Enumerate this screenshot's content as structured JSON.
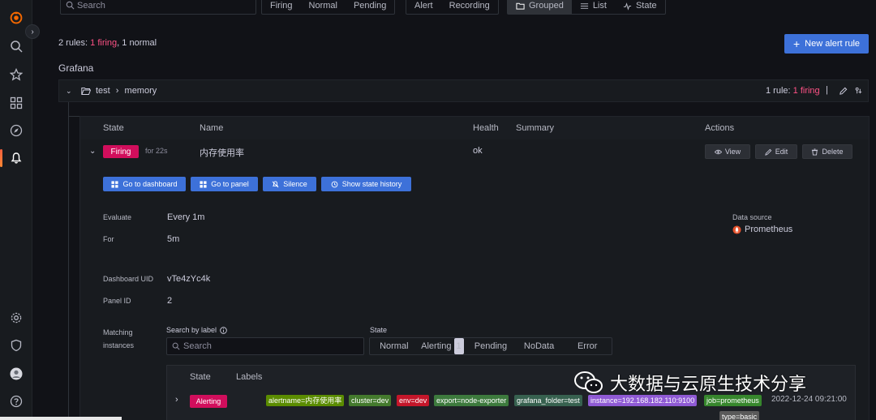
{
  "top_filters": {
    "search_placeholder": "Search",
    "states": [
      "Firing",
      "Normal",
      "Pending"
    ],
    "types": [
      "Alert",
      "Recording"
    ],
    "views": [
      "Grouped",
      "List",
      "State"
    ]
  },
  "summary": {
    "prefix": "2 rules: ",
    "firing": "1 firing",
    "sep": ", ",
    "normal": "1 normal"
  },
  "new_alert_label": "New alert rule",
  "datasource_group": "Grafana",
  "folder": {
    "folder_name": "test",
    "separator": "›",
    "group_name": "memory",
    "count_prefix": "1 rule: ",
    "count_firing": "1 firing",
    "divider": "|"
  },
  "rule_table": {
    "headers": {
      "state": "State",
      "name": "Name",
      "health": "Health",
      "summary": "Summary",
      "actions": "Actions"
    },
    "row": {
      "state": "Firing",
      "duration": "for 22s",
      "name": "内存使用率",
      "health": "ok",
      "actions": [
        "View",
        "Edit",
        "Delete"
      ]
    }
  },
  "quick_actions": [
    "Go to dashboard",
    "Go to panel",
    "Silence",
    "Show state history"
  ],
  "details": {
    "evaluate_label": "Evaluate",
    "evaluate_value": "Every 1m",
    "for_label": "For",
    "for_value": "5m",
    "dashboard_uid_label": "Dashboard UID",
    "dashboard_uid_value": "vTe4zYc4k",
    "panel_id_label": "Panel ID",
    "panel_id_value": "2",
    "datasource_label": "Data source",
    "datasource_value": "Prometheus"
  },
  "instances": {
    "label_line1": "Matching",
    "label_line2": "instances",
    "search_label": "Search by label",
    "search_placeholder": "Search",
    "state_label": "State",
    "state_filters": [
      "Normal",
      "Alerting",
      "Pending",
      "NoData",
      "Error"
    ],
    "alerting_count": "1",
    "headers": {
      "state": "State",
      "labels": "Labels"
    },
    "row": {
      "state": "Alerting",
      "tags": [
        {
          "text": "alertname=内存使用率",
          "color": "#5b8c00"
        },
        {
          "text": "cluster=dev",
          "color": "#447a2d"
        },
        {
          "text": "env=dev",
          "color": "#c4162a"
        },
        {
          "text": "export=node-exporter",
          "color": "#3d7a3d"
        },
        {
          "text": "grafana_folder=test",
          "color": "#37614f"
        },
        {
          "text": "instance=192.168.182.110:9100",
          "color": "#8f5ad4"
        },
        {
          "text": "job=prometheus",
          "color": "#37872d"
        },
        {
          "text": "type=basic",
          "color": "#5a5a5a"
        }
      ],
      "timestamp": "2022-12-24 09:21:00"
    }
  },
  "watermark": "大数据与云原生技术分享",
  "colors": {
    "firing": "#d10e5c",
    "primary": "#3d71d9",
    "accent": "#ff5286"
  }
}
